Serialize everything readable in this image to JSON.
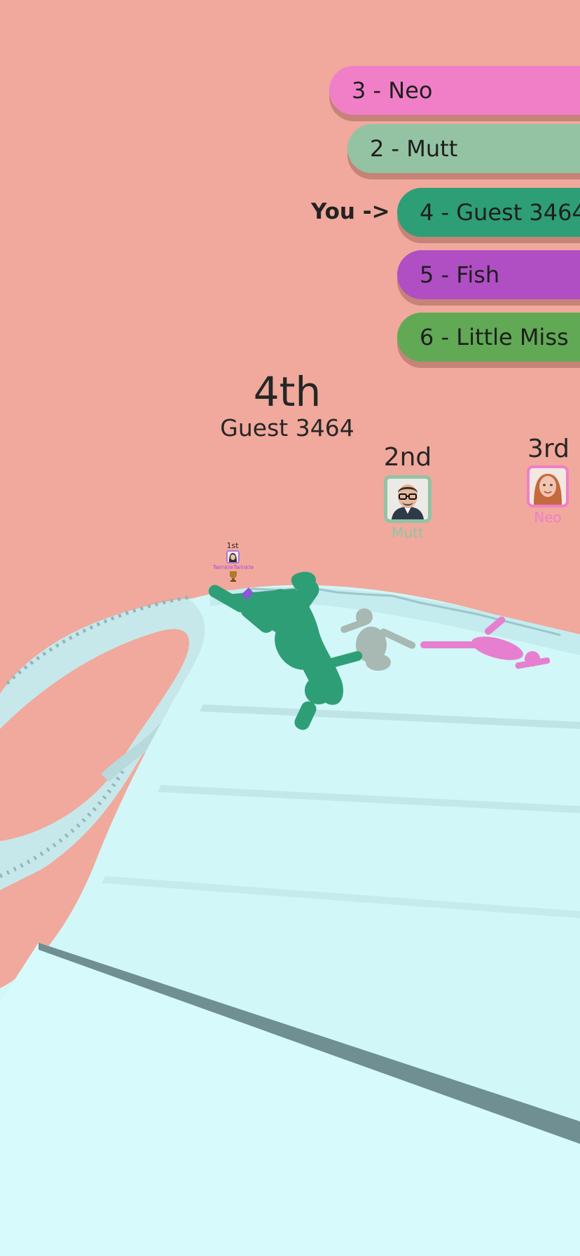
{
  "leaderboard": {
    "you_label": "You ->",
    "rows": [
      {
        "text": "3 - Neo",
        "color": "#f07fc7"
      },
      {
        "text": "2 - Mutt",
        "color": "#93c3a3"
      },
      {
        "text": "4 - Guest 3464",
        "color": "#2e9e76"
      },
      {
        "text": "5 - Fish",
        "color": "#b04ec4"
      },
      {
        "text": "6 - Little Miss",
        "color": "#61a955"
      }
    ]
  },
  "player": {
    "place": "4th",
    "name": "Guest 3464"
  },
  "rivals": {
    "second": {
      "place": "2nd",
      "name": "Mutt",
      "color": "#93c3a3"
    },
    "third": {
      "place": "3rd",
      "name": "Neo",
      "color": "#f07fc7"
    },
    "first": {
      "place": "1st",
      "name": "TwinkleTwinkle",
      "color": "#b574d8"
    }
  },
  "scene": {
    "background_color": "#f0a99c",
    "stair_color": "#d7fbfc",
    "player_color": "#2e9e76",
    "rival_colors": [
      "#a8b8b2",
      "#e77fd0"
    ]
  }
}
